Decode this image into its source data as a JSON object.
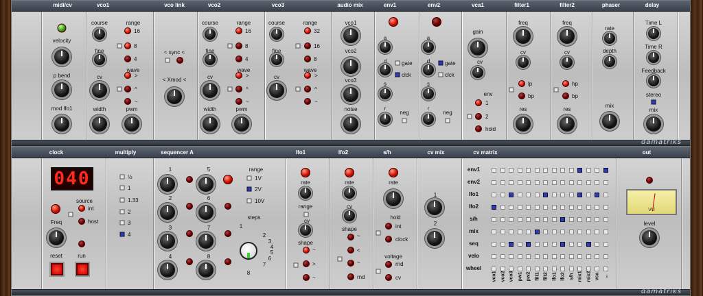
{
  "top": {
    "titles": [
      "midi/cv",
      "vco1",
      "vco link",
      "vco2",
      "vco3",
      "audio mix",
      "env1",
      "env2",
      "vca1",
      "filter1",
      "filter2",
      "phaser",
      "delay"
    ],
    "midi": {
      "velocity": "velocity",
      "pbend": "p bend",
      "modlfo": "mod lfo1"
    },
    "vco1": {
      "course": "course",
      "fine": "fine",
      "cv": "cv",
      "width": "width",
      "range": "range",
      "r16": "16",
      "r8": "8",
      "r4": "4",
      "wave": "wave",
      "w1": ">",
      "w2": "^",
      "w3": "~",
      "pwm": "pwm"
    },
    "link": {
      "sync": "< sync <",
      "xmod": "< Xmod <"
    },
    "vco2": {
      "course": "course",
      "fine": "fine",
      "cv": "cv",
      "width": "width",
      "range": "range",
      "r16": "16",
      "r8": "8",
      "r4": "4",
      "wave": "wave",
      "w1": ">",
      "w2": "^",
      "w3": "~",
      "pwm": "pwm"
    },
    "vco3": {
      "course": "course",
      "fine": "fine",
      "cv": "cv",
      "range": "range",
      "r32": "32",
      "r16": "16",
      "r8": "8",
      "wave": "wave",
      "w1": ">",
      "w2": "^",
      "w3": "~"
    },
    "mix": {
      "vco1": "vco1",
      "vco2": "vco2",
      "vco3": "vco3",
      "noise": "noise"
    },
    "env1": {
      "a": "a",
      "d": "d",
      "s": "s",
      "r": "r",
      "gate": "gate",
      "clck": "clck",
      "neg": "neg"
    },
    "env2": {
      "a": "a",
      "d": "d",
      "s": "s",
      "r": "r",
      "gate": "gate",
      "clck": "clck",
      "neg": "neg"
    },
    "vca": {
      "gain": "gain",
      "cv": "cv",
      "env": "env",
      "e1": "1",
      "e2": "2",
      "hold": "hold"
    },
    "filter1": {
      "freq": "freq",
      "cv": "cv",
      "lp": "lp",
      "bp": "bp",
      "res": "res"
    },
    "filter2": {
      "freq": "freq",
      "cv": "cv",
      "hp": "hp",
      "bp": "bp",
      "res": "res"
    },
    "phaser": {
      "rate": "rate",
      "depth": "depth",
      "mix": "mix"
    },
    "delay": {
      "timel": "Time L",
      "timer": "Time R",
      "feedback": "Feedback",
      "stereo": "stereo",
      "mix": "mix"
    }
  },
  "bottom": {
    "titles": [
      "clock",
      "multiply",
      "sequencer A",
      "lfo1",
      "lfo2",
      "s/h",
      "cv mix",
      "cv matrix",
      "out"
    ],
    "clock": {
      "display": "040",
      "source": "source",
      "int": "int",
      "host": "host",
      "freq": "Freq",
      "reset": "reset",
      "run": "run"
    },
    "multiply": [
      "½",
      "1",
      "1.33",
      "2",
      "3",
      "4"
    ],
    "seq": {
      "nums": [
        "1",
        "2",
        "3",
        "4",
        "5",
        "6",
        "7",
        "8"
      ],
      "range": "range",
      "r1": "1V",
      "r2": "2V",
      "r3": "10V",
      "steps": "steps",
      "s": [
        "1",
        "2",
        "3",
        "4",
        "5",
        "6",
        "7",
        "8"
      ]
    },
    "lfo1": {
      "rate": "rate",
      "range": "range",
      "cv": "cv",
      "shape": "shape",
      "s1": "~",
      "s2": ">",
      "s3": "~"
    },
    "lfo2": {
      "rate": "rate",
      "cv": "cv",
      "shape": "shape",
      "s1": "~",
      "s2": "<",
      "s3": "~",
      "s4": "rnd"
    },
    "sh": {
      "rate": "rate",
      "hold": "hold",
      "int": "int",
      "clock": "clock",
      "voltage": "voltage",
      "rnd": "rnd",
      "cv": "cv"
    },
    "cvmix": {
      "k1": "1",
      "k2": "2"
    },
    "matrix": {
      "rows": [
        "env1",
        "env2",
        "lfo1",
        "lfo2",
        "s/h",
        "mix",
        "seq",
        "velo",
        "wheel"
      ],
      "cols": [
        "vco1",
        "vco2",
        "vco3",
        "pw1",
        "pw2",
        "filt1",
        "filt2",
        "lfo1",
        "lfo2",
        "s/h",
        "mix1",
        "mix2",
        "vca",
        "..."
      ],
      "on": [
        [
          10,
          0
        ],
        [
          2,
          2
        ],
        [
          6,
          2
        ],
        [
          10,
          2
        ],
        [
          0,
          3
        ],
        [
          8,
          4
        ],
        [
          5,
          5
        ],
        [
          2,
          6
        ],
        [
          4,
          6
        ],
        [
          8,
          6
        ],
        [
          11,
          6
        ],
        [
          13,
          0
        ],
        [
          12,
          2
        ]
      ]
    },
    "out": {
      "vu": "VU",
      "level": "level"
    }
  },
  "brand": "damatriks",
  "colors": {
    "led": "#d01000",
    "switch": "#2a3ab8",
    "bar": "#4a535e"
  }
}
